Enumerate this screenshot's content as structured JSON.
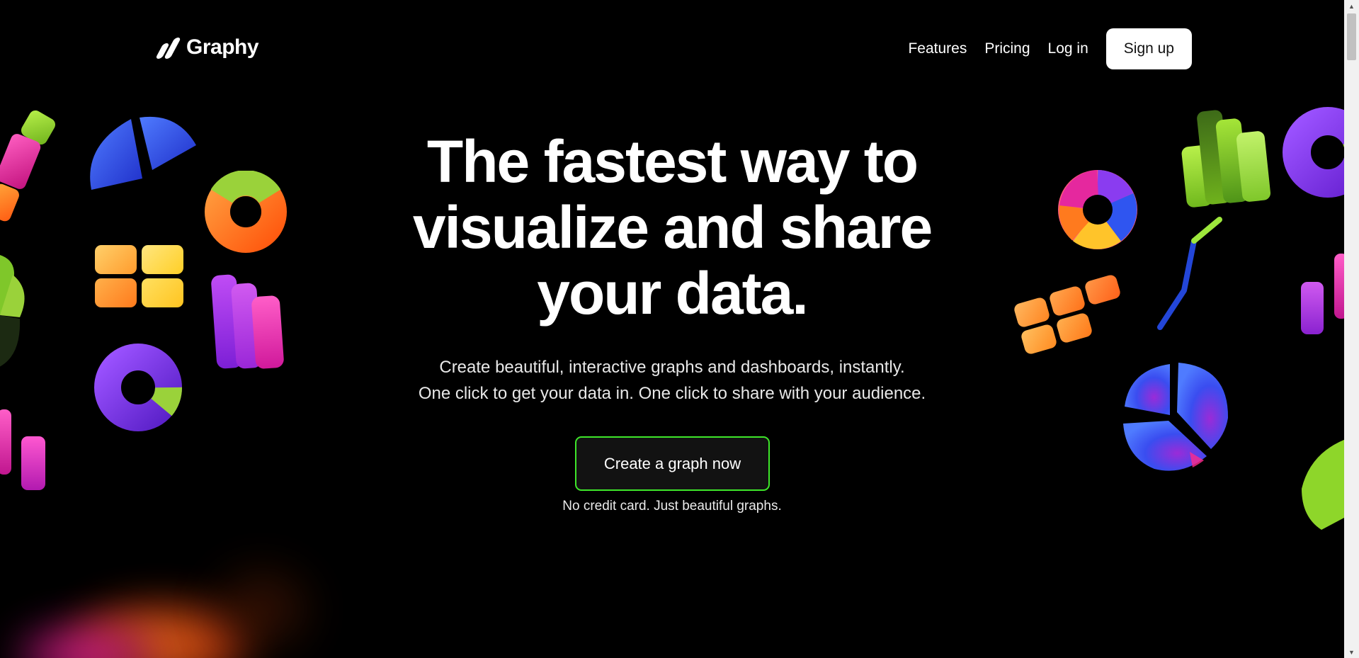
{
  "nav": {
    "logo_text": "Graphy",
    "logo_icon": "graphy-slash-logo-icon",
    "links": {
      "features": "Features",
      "pricing": "Pricing",
      "login": "Log in"
    },
    "signup_label": "Sign up"
  },
  "hero": {
    "title_lines": [
      "The fastest way to",
      "visualize and share",
      "your data."
    ],
    "subtitle_lines": [
      "Create beautiful, interactive graphs and dashboards, instantly.",
      "One click to get your data in. One click to share with your audience."
    ],
    "cta_label": "Create a graph now",
    "cta_note": "No credit card. Just beautiful graphs."
  },
  "colors": {
    "background": "#000000",
    "cta_border": "#3ee62a",
    "accent_green": "#8ed62a",
    "accent_blue": "#2f55f0",
    "accent_purple": "#8a3cf0",
    "accent_pink": "#e5289e",
    "accent_orange": "#ff7a1e",
    "accent_yellow": "#ffd230"
  },
  "decor_icons": [
    "pie-chart-icon",
    "donut-chart-icon",
    "tile-grid-icon",
    "bar-chart-icon",
    "line-chart-icon"
  ],
  "scrollbar": {
    "up_icon": "scroll-up-arrow-icon",
    "down_icon": "scroll-down-arrow-icon"
  }
}
